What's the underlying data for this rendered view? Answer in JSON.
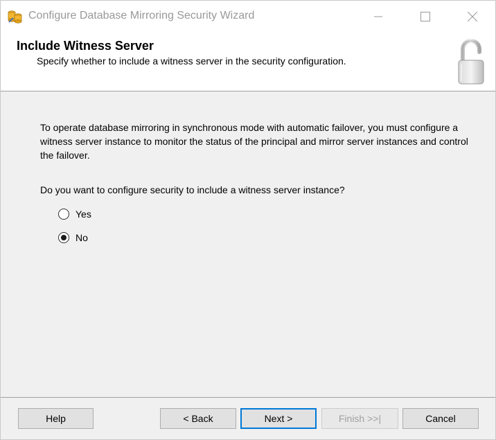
{
  "window": {
    "title": "Configure Database Mirroring Security Wizard"
  },
  "header": {
    "title": "Include Witness Server",
    "subtitle": "Specify whether to include a witness server in the security configuration.",
    "icon": "open-padlock-icon"
  },
  "body": {
    "description": "To operate database mirroring in synchronous mode with automatic failover, you must configure a witness server instance to monitor the status of the principal and mirror server instances and control the failover.",
    "question": "Do you want to configure security to include a witness server instance?",
    "options": [
      {
        "label": "Yes",
        "selected": false
      },
      {
        "label": "No",
        "selected": true
      }
    ]
  },
  "footer": {
    "help_label": "Help",
    "back_label": "< Back",
    "next_label": "Next >",
    "finish_label": "Finish >>|",
    "cancel_label": "Cancel",
    "finish_enabled": false
  },
  "colors": {
    "default_button_border": "#0078d7",
    "dialog_background": "#f0f0f0"
  }
}
